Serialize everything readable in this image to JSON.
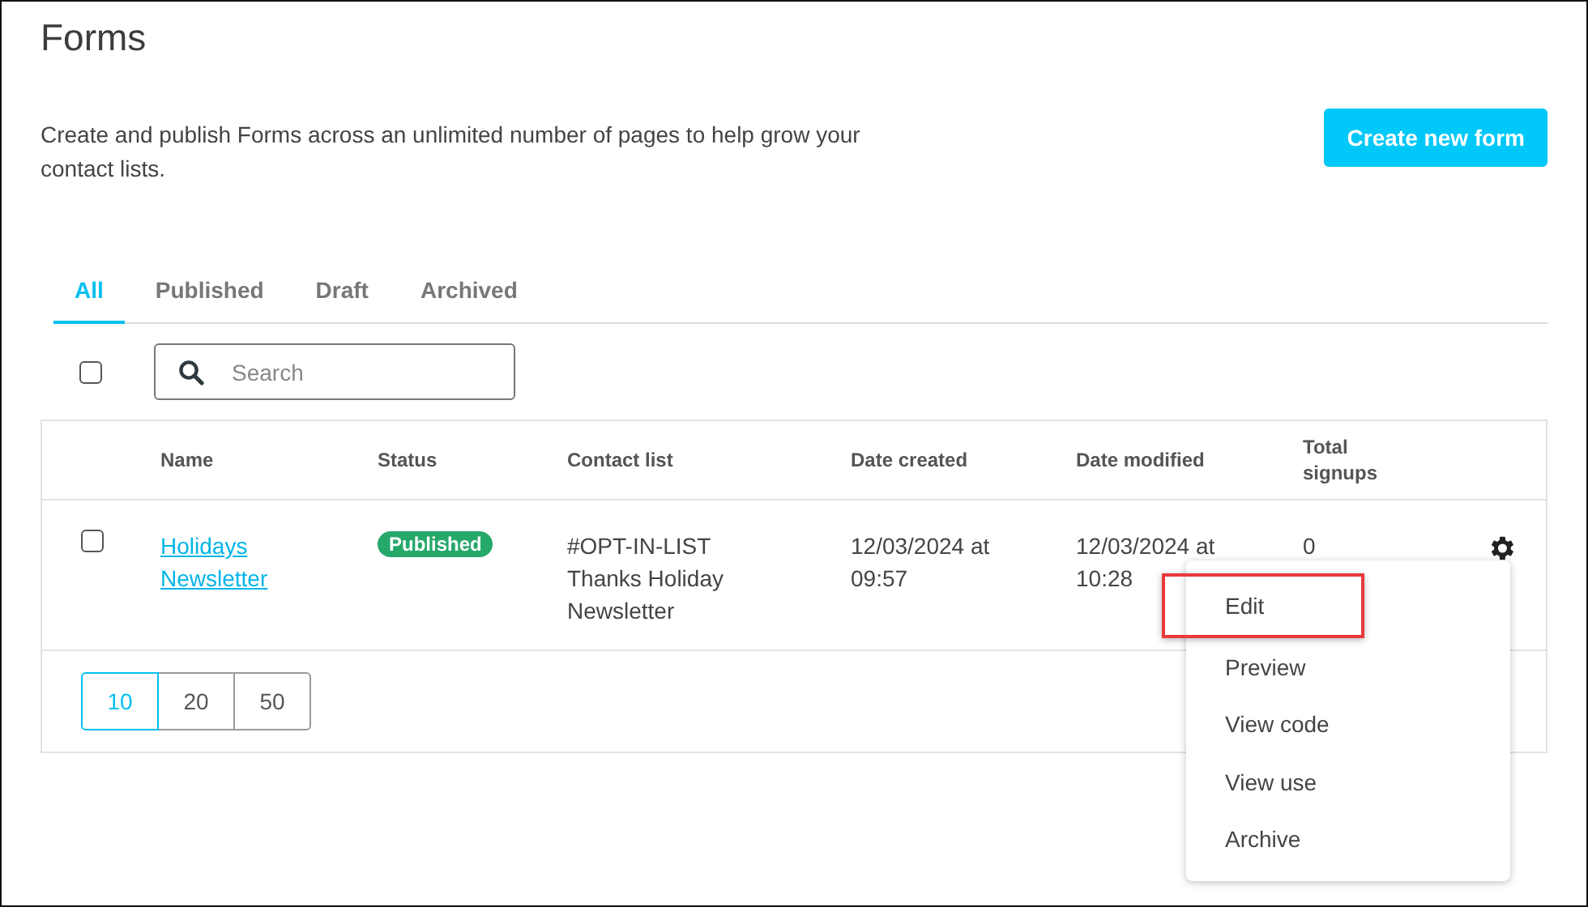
{
  "page": {
    "title": "Forms",
    "description": "Create and publish Forms across an unlimited number of pages to help grow your contact lists.",
    "create_button": "Create new form"
  },
  "tabs": [
    {
      "label": "All",
      "selected": true
    },
    {
      "label": "Published",
      "selected": false
    },
    {
      "label": "Draft",
      "selected": false
    },
    {
      "label": "Archived",
      "selected": false
    }
  ],
  "toolbar": {
    "select_all_checked": false,
    "search": {
      "placeholder": "Search"
    }
  },
  "table": {
    "columns": [
      "Name",
      "Status",
      "Contact list",
      "Date created",
      "Date modified",
      "Total signups"
    ],
    "rows": [
      {
        "checked": false,
        "name": "Holidays Newsletter",
        "status": {
          "label": "Published",
          "color": "#27a86b"
        },
        "contact_list": "#OPT-IN-LIST Thanks Holiday Newsletter",
        "date_created": "12/03/2024 at 09:57",
        "date_modified": "12/03/2024 at 10:28",
        "total_signups": "0"
      }
    ]
  },
  "page_sizes": [
    {
      "label": "10",
      "selected": true
    },
    {
      "label": "20",
      "selected": false
    },
    {
      "label": "50",
      "selected": false
    }
  ],
  "context_menu": {
    "items": [
      {
        "label": "Edit",
        "highlighted": true
      },
      {
        "label": "Preview",
        "highlighted": false
      },
      {
        "label": "View code",
        "highlighted": false
      },
      {
        "label": "View use",
        "highlighted": false
      },
      {
        "label": "Archive",
        "highlighted": false
      }
    ]
  }
}
